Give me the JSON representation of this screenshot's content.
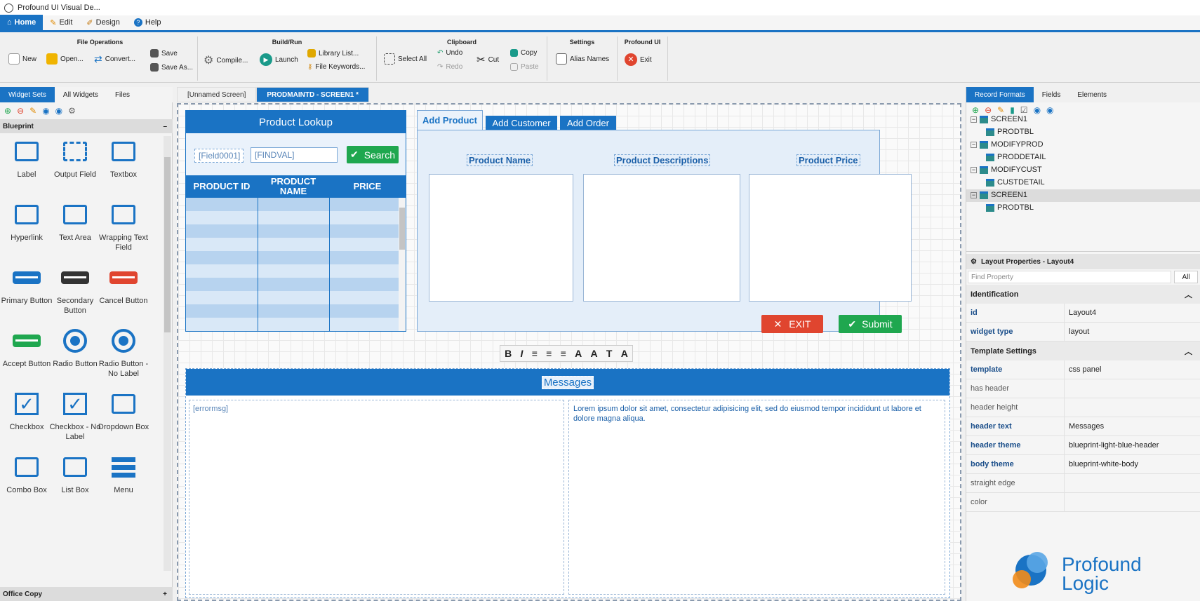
{
  "window": {
    "title": "Profound UI Visual De..."
  },
  "menu": [
    "Home",
    "Edit",
    "Design",
    "Help"
  ],
  "ribbon": {
    "file_ops": {
      "title": "File Operations",
      "new": "New",
      "open": "Open...",
      "convert": "Convert...",
      "save": "Save",
      "save_as": "Save As..."
    },
    "build": {
      "title": "Build/Run",
      "compile": "Compile...",
      "launch": "Launch",
      "library": "Library List...",
      "keywords": "File Keywords..."
    },
    "clipboard": {
      "title": "Clipboard",
      "select_all": "Select All",
      "undo": "Undo",
      "redo": "Redo",
      "cut": "Cut",
      "copy": "Copy",
      "paste": "Paste"
    },
    "settings": {
      "title": "Settings",
      "alias": "Alias Names"
    },
    "pui": {
      "title": "Profound UI",
      "exit": "Exit"
    }
  },
  "left": {
    "tabs": [
      "Widget Sets",
      "All Widgets",
      "Files"
    ],
    "section": "Blueprint",
    "footer": "Office Copy",
    "widgets": [
      "Label",
      "Output Field",
      "Textbox",
      "Hyperlink",
      "Text Area",
      "Wrapping Text Field",
      "Primary Button",
      "Secondary Button",
      "Cancel Button",
      "Accept Button",
      "Radio Button",
      "Radio Button - No Label",
      "Checkbox",
      "Checkbox - No Label",
      "Dropdown Box",
      "Combo Box",
      "List Box",
      "Menu"
    ]
  },
  "doc_tabs": [
    "[Unnamed Screen]",
    "PRODMAINTD - SCREEN1 *"
  ],
  "lookup": {
    "title": "Product Lookup",
    "field": "[Field0001]",
    "findval": "[FINDVAL]",
    "search": "Search",
    "cols": [
      "PRODUCT ID",
      "PRODUCT NAME",
      "PRICE"
    ]
  },
  "tabs": {
    "items": [
      "Add Product",
      "Add Customer",
      "Add Order"
    ],
    "labels": [
      "Product Name",
      "Product Descriptions",
      "Product Price"
    ],
    "exit": "EXIT",
    "submit": "Submit"
  },
  "messages": {
    "header": "Messages",
    "errmsg": "[errormsg]",
    "lorem": "Lorem ipsum dolor sit amet, consectetur adipisicing elit, sed do eiusmod tempor incididunt ut labore et dolore magna aliqua."
  },
  "right": {
    "tabs": [
      "Record Formats",
      "Fields",
      "Elements"
    ],
    "tree": [
      {
        "name": "SCREEN1",
        "child": "PRODTBL"
      },
      {
        "name": "MODIFYPROD",
        "child": "PRODDETAIL"
      },
      {
        "name": "MODIFYCUST",
        "child": "CUSTDETAIL"
      },
      {
        "name": "SCREEN1",
        "child": "PRODTBL"
      }
    ],
    "props_title": "Layout Properties - Layout4",
    "find": "Find Property",
    "all": "All",
    "sect1": "Identification",
    "sect2": "Template Settings",
    "props1": [
      [
        "id",
        "Layout4"
      ],
      [
        "widget type",
        "layout"
      ]
    ],
    "props2": [
      [
        "template",
        "css panel"
      ],
      [
        "has header",
        ""
      ],
      [
        "header height",
        ""
      ],
      [
        "header text",
        "Messages"
      ],
      [
        "header theme",
        "blueprint-light-blue-header"
      ],
      [
        "body theme",
        "blueprint-white-body"
      ],
      [
        "straight edge",
        ""
      ],
      [
        "color",
        ""
      ]
    ],
    "logo1": "Profound",
    "logo2": "Logic"
  }
}
